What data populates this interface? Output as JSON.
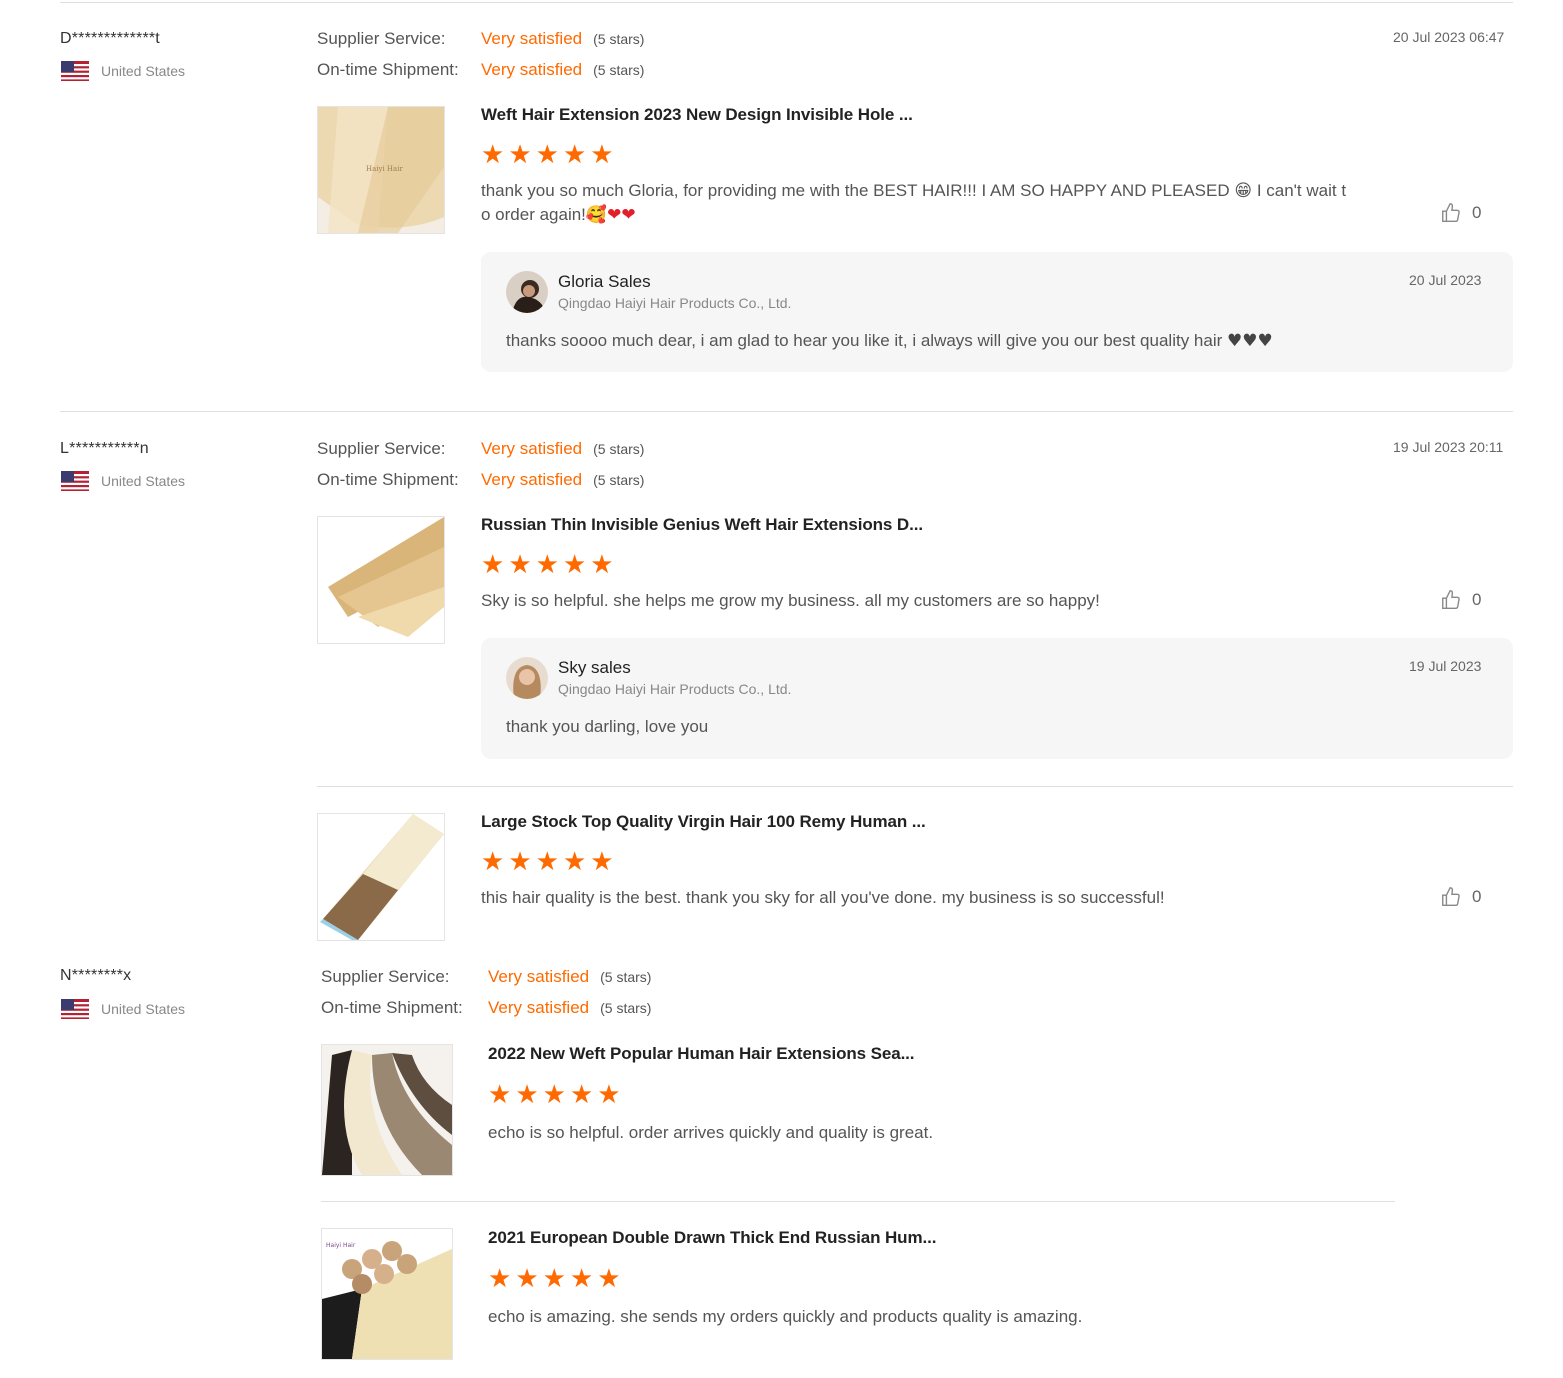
{
  "reviews": [
    {
      "buyer": "D*************t",
      "country": "United States",
      "supplier_service_label": "Supplier Service:",
      "supplier_service_value": "Very satisfied",
      "supplier_service_stars": "(5 stars)",
      "shipment_label": "On-time Shipment:",
      "shipment_value": "Very satisfied",
      "shipment_stars": "(5 stars)",
      "date": "20 Jul 2023 06:47",
      "items": [
        {
          "title": "Weft Hair Extension 2023 New Design Invisible Hole ...",
          "rating": 5,
          "text_line1": "thank you so much Gloria, for providing me with the BEST HAIR!!! I AM SO HAPPY AND PLEASED",
          "text_line1_end": "I can't wait t",
          "text_line2": "o order again!",
          "likes": "0",
          "reply": {
            "name": "Gloria Sales",
            "company": "Qingdao Haiyi Hair Products Co., Ltd.",
            "date": "20 Jul 2023",
            "text": "thanks soooo  much dear, i am glad to hear you like it, i always will give you our best quality hair"
          }
        }
      ]
    },
    {
      "buyer": "L***********n",
      "country": "United States",
      "supplier_service_label": "Supplier Service:",
      "supplier_service_value": "Very satisfied",
      "supplier_service_stars": "(5 stars)",
      "shipment_label": "On-time Shipment:",
      "shipment_value": "Very satisfied",
      "shipment_stars": "(5 stars)",
      "date": "19 Jul 2023 20:11",
      "items": [
        {
          "title": "Russian Thin Invisible Genius Weft Hair Extensions D...",
          "rating": 5,
          "text": "Sky is so helpful. she helps me grow my business. all my customers are so happy!",
          "likes": "0",
          "reply": {
            "name": "Sky sales",
            "company": "Qingdao Haiyi Hair Products Co., Ltd.",
            "date": "19 Jul 2023",
            "text": "thank you darling, love you"
          }
        },
        {
          "title": "Large Stock Top Quality Virgin Hair 100 Remy Human ...",
          "rating": 5,
          "text": "this hair quality is the best. thank you sky for all you've done. my business is so successful!",
          "likes": "0"
        }
      ]
    },
    {
      "buyer": "N********x",
      "country": "United States",
      "supplier_service_label": "Supplier Service:",
      "supplier_service_value": "Very satisfied",
      "supplier_service_stars": "(5 stars)",
      "shipment_label": "On-time Shipment:",
      "shipment_value": "Very satisfied",
      "shipment_stars": "(5 stars)",
      "items": [
        {
          "title": "2022 New Weft Popular Human Hair Extensions Sea...",
          "rating": 5,
          "text": "echo is so helpful. order arrives quickly and quality is great."
        },
        {
          "title": "2021 European Double Drawn Thick End Russian Hum...",
          "rating": 5,
          "text": "echo is amazing. she sends my orders quickly and products quality is amazing."
        }
      ]
    }
  ],
  "icons": {
    "flag": "us-flag-icon",
    "like": "thumbs-up-icon",
    "star": "star-icon"
  },
  "colors": {
    "accent": "#ff6a00",
    "reply_bg": "#f6f6f6",
    "divider": "#e0e0e0"
  }
}
